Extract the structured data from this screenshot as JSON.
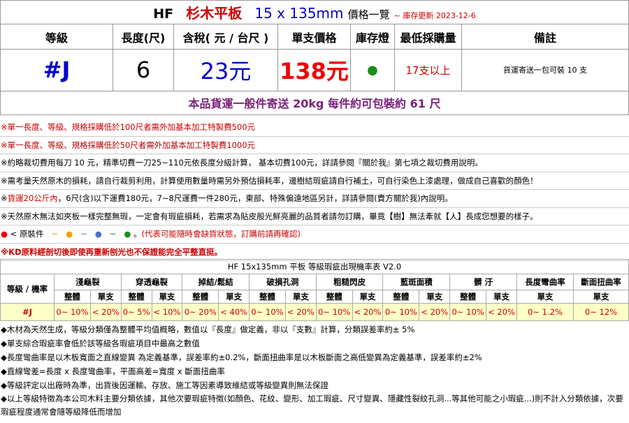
{
  "title": {
    "brand": "HF",
    "name": "杉木平板",
    "size": "15 x 135mm",
    "list": "價格一覽",
    "date": "~ 庫存更新 2023-12-6"
  },
  "headers": [
    "等級",
    "長度(尺)",
    "含稅( 元 / 台尺 )",
    "單支價格",
    "庫存燈",
    "最低採購量",
    "備註"
  ],
  "product": {
    "grade": "#J",
    "length": "6",
    "price_per": "23元",
    "unit_price": "138元",
    "stock_dot": "●",
    "stock_color": "#1a8f1a",
    "min_qty": "17支以上",
    "note": "貨運寄送一包可裝 10 支"
  },
  "shipping": "本品貨運一般件寄送 20kg 每件約可包裝約 61 尺",
  "notes": [
    "※單一長度、等級、規格採購低於100尺者需外加基本加工特製費500元",
    "※單一長度、等級、規格採購低於50尺者需外加基本加工特製費1000元",
    "※約略裁切費用每刀 10 元，精準切費一刀25~110元依長度分級計算， 基本切費100元，詳請參閱『關於我』第七項之裁切費用說明。",
    "※需考量天然原木的損耗，請自行裁剪利用，計算使用數量時需另外預估損耗率，邊樹結瑕疵請自行補土，可自行染色上漆處理，做成自己喜歡的顏色！",
    "※天然原木無法如夾板一樣完整無瑕，一定會有瑕疵損耗，若需求為貼皮般光鮮亮麗的品質者請勿訂購，畢竟【樹】無法牽就【人】長成您想要的樣子。"
  ],
  "note5": {
    "prefix": "※",
    "red": "貨運20公斤內",
    "rest": "，6尺(含)以下運費180元，7~8尺運費一件280元，東部、特殊偏遠地區另計，詳請參閱(賣方關於我)內說明。"
  },
  "legend": {
    "label": "< 原裝件",
    "tilde": "~",
    "warning": "(代表可能隨時會缺貨狀態，訂購前請再確認)"
  },
  "kd_note": "※KD原料經剖切後即使再重新刨光也不保證能完全平整直挺。",
  "defect": {
    "title": "HF  15x135mm 平板 等級瑕疵出現機率表 V2.0",
    "row_label": "等級 / 機率",
    "groups": [
      "淺龜裂",
      "穿透龜裂",
      "掉結/鬆結",
      "破損孔洞",
      "粗糙閃皮",
      "藍斑面積",
      "髒 汙"
    ],
    "single_groups": [
      "長度彎曲率",
      "斷面扭曲率"
    ],
    "sub": [
      "整體",
      "單支"
    ],
    "grade": "#J",
    "values": [
      "0~ 10%",
      "< 20%",
      "0~ 5%",
      "< 10%",
      "0~ 20%",
      "< 40%",
      "0~ 10%",
      "< 20%",
      "0~ 10%",
      "< 20%",
      "0~ 10%",
      "< 20%",
      "0~ 10%",
      "< 20%"
    ],
    "single_values": [
      "0~ 1.2%",
      "0~ 12%"
    ]
  },
  "footnotes": [
    "◆木材為天然生成，等級分類僅為整體平均值概略，數值以『長度』做定義，非以『支數』計算，分類誤差率約± 5%",
    "◆單支綜合瑕疵率會低於該等級各瑕疵項目中最高之數值",
    "◆長度彎曲率是以木板寬面之直線變異 為定義基準，誤差率約±0.2%，斷面扭曲率是以木板斷面之高低變異為定義基準，誤差率約±2%",
    "◆直線彎差=長度 x 長度彎曲率，平面高差=寬度 x 斷面扭曲率",
    "◆等級評定以出廠時為準，出貨後因運輸、存放、施工等因素導致維結或等級變異則無法保證",
    "◆以上等級特徵為本公司木料主要分類依據，其他次要瑕疵特徵(如顏色、花紋、變形、加工瑕疵、尺寸變異、隱藏性裂紋孔洞...等其他可能之小瑕疵...)則不計入分類依據，次要瑕疵程度通常會隨等級降低而增加"
  ]
}
